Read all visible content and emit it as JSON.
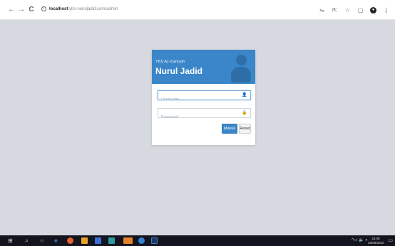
{
  "browser": {
    "back_icon": "←",
    "forward_icon": "→",
    "reload_icon": "C",
    "url_host": "localhost",
    "url_path": "/ybs-nuruljadid.com/admin",
    "info_icon": "i",
    "toolbar_icons": [
      "translate-icon",
      "share-icon",
      "star-icon",
      "sidebar-icon",
      "profile-icon",
      "menu-icon"
    ]
  },
  "login": {
    "org_name": "YBS Az-Zainiyah",
    "app_name": "Nurul Jadid",
    "username_placeholder": "Username",
    "password_placeholder": "Password",
    "login_label": "Masuk",
    "reset_label": "Reset",
    "header_color": "#3a86c8"
  },
  "taskbar": {
    "time": "23.08",
    "date": "25/08/2022",
    "tray_arrow": "^",
    "tray_icons": "▭ 🔈 ◐"
  }
}
